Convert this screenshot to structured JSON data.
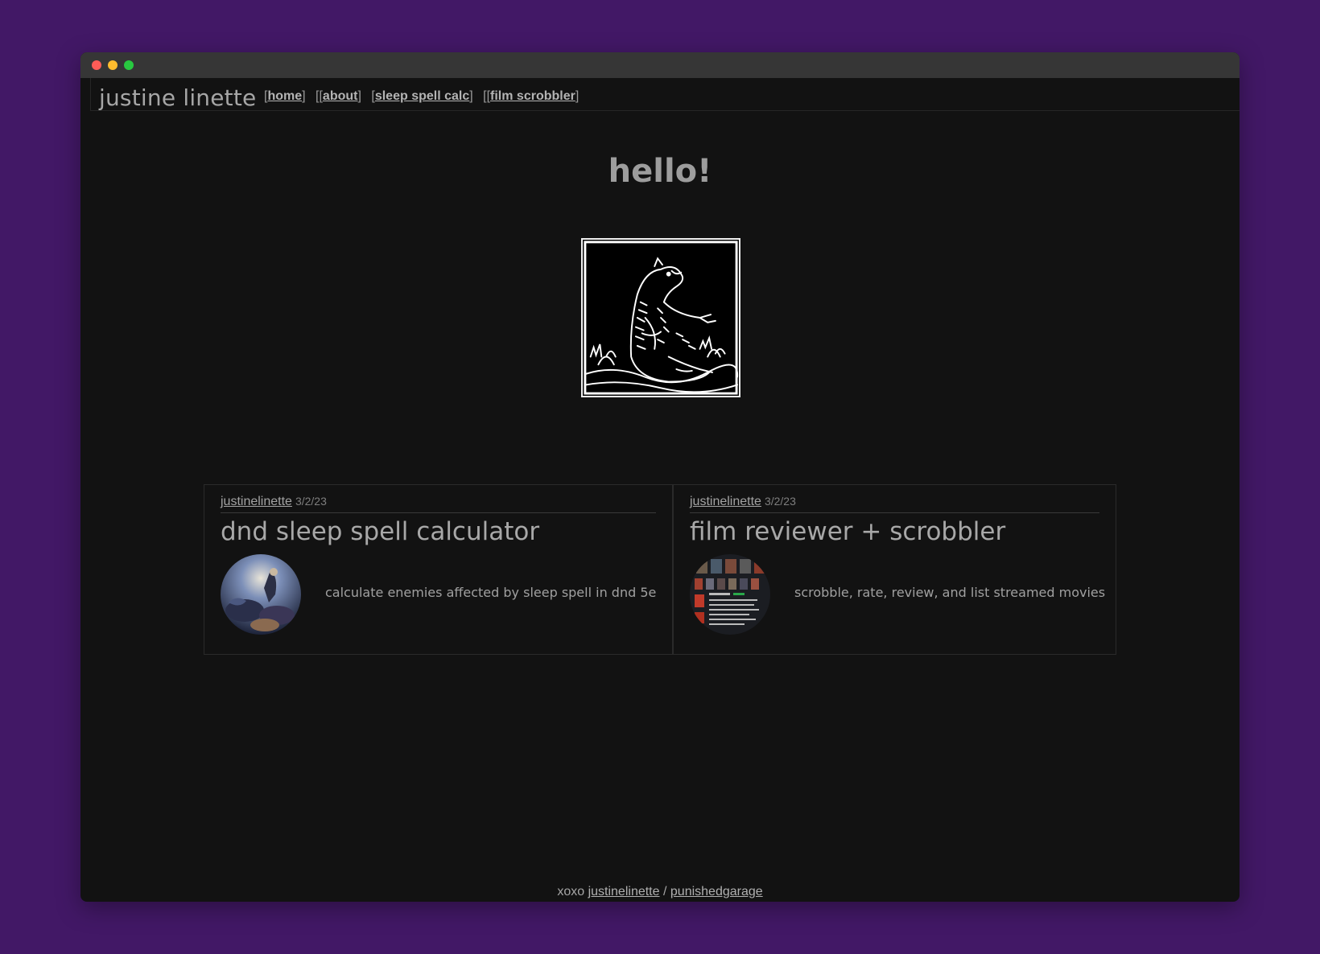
{
  "site": {
    "title": "justine linette"
  },
  "nav": [
    {
      "prefix": "[",
      "label": "home",
      "suffix": "]"
    },
    {
      "prefix": "[[",
      "label": "about",
      "suffix": "]"
    },
    {
      "prefix": "[",
      "label": "sleep spell calc",
      "suffix": "]"
    },
    {
      "prefix": "[[",
      "label": "film scrobbler",
      "suffix": "]"
    }
  ],
  "main": {
    "greeting": "hello!"
  },
  "cards": [
    {
      "author": "justinelinette",
      "date": "3/2/23",
      "title": "dnd sleep spell calculator",
      "description": "calculate enemies affected by sleep spell in dnd 5e"
    },
    {
      "author": "justinelinette",
      "date": "3/2/23",
      "title": "film reviewer + scrobbler",
      "description": "scrobble, rate, review, and list streamed movies"
    }
  ],
  "footer": {
    "prefix": "xoxo",
    "link1": "justinelinette",
    "separator": "/",
    "link2": "punishedgarage"
  },
  "colors": {
    "background": "#421866",
    "window": "#121212",
    "titlebar": "#363636"
  }
}
